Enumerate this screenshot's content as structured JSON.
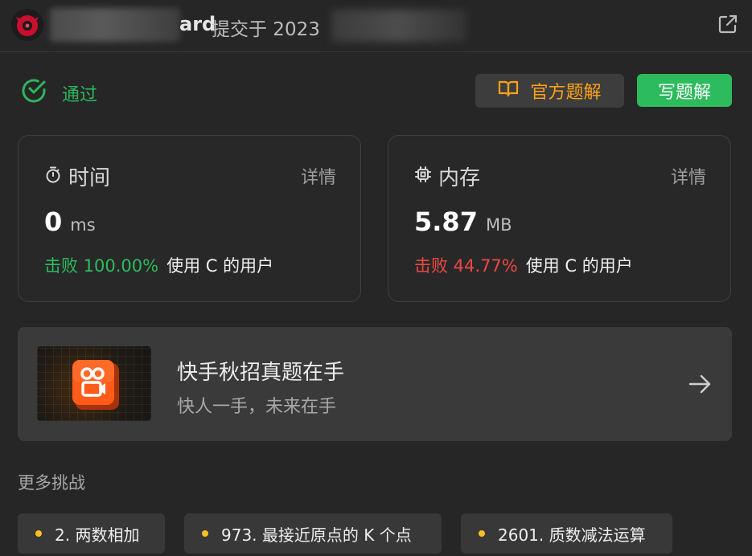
{
  "header": {
    "user_suffix": "ard",
    "submitted_label": "提交于 2023",
    "open_icon": "external-link-icon"
  },
  "status": {
    "label": "通过",
    "color": "#2db55d",
    "icon": "check-circle-icon"
  },
  "actions": {
    "official_solution": "官方题解",
    "official_icon": "book-open-icon",
    "write_solution": "写题解"
  },
  "time_card": {
    "title": "时间",
    "icon": "stopwatch-icon",
    "detail": "详情",
    "value": "0",
    "unit": "ms",
    "beat_label": "击败 100.00%",
    "beat_tail": "使用 C 的用户"
  },
  "memory_card": {
    "title": "内存",
    "icon": "chip-icon",
    "detail": "详情",
    "value": "5.87",
    "unit": "MB",
    "beat_label": "击败 44.77%",
    "beat_tail": "使用 C 的用户"
  },
  "banner": {
    "title": "快手秋招真题在手",
    "subtitle": "快人一手，未来在手",
    "logo_icon": "kuaishou-logo-icon",
    "arrow_icon": "arrow-right-icon"
  },
  "more": {
    "title": "更多挑战",
    "challenges": [
      "2. 两数相加",
      "973. 最接近原点的 K 个点",
      "2601. 质数减法运算"
    ]
  },
  "colors": {
    "accent_orange": "#ffa116",
    "success_green": "#2cbb5d",
    "fail_red": "#ef4743",
    "dot_yellow": "#ffc01e"
  }
}
